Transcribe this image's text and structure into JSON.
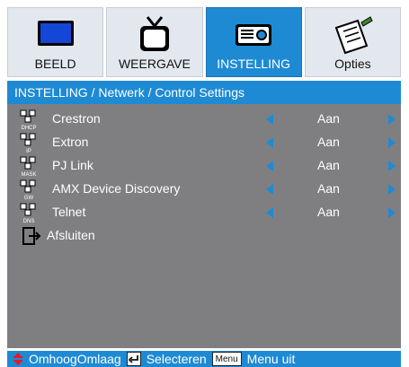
{
  "tabs": [
    {
      "label": "BEELD",
      "icon": "monitor-icon",
      "active": false
    },
    {
      "label": "WEERGAVE",
      "icon": "tv-icon",
      "active": false
    },
    {
      "label": "INSTELLING",
      "icon": "projector-icon",
      "active": true
    },
    {
      "label": "Opties",
      "icon": "notepad-icon",
      "active": false
    }
  ],
  "breadcrumb": "INSTELLING / Netwerk / Control Settings",
  "items": [
    {
      "label": "Crestron",
      "value": "Aan",
      "icon_text": "DHCP"
    },
    {
      "label": "Extron",
      "value": "Aan",
      "icon_text": "IP"
    },
    {
      "label": "PJ Link",
      "value": "Aan",
      "icon_text": "MASK"
    },
    {
      "label": "AMX Device Discovery",
      "value": "Aan",
      "icon_text": "GW"
    },
    {
      "label": "Telnet",
      "value": "Aan",
      "icon_text": "DNS"
    }
  ],
  "exit": {
    "label": "Afsluiten",
    "icon": "exit-icon"
  },
  "footer": {
    "updown_label": "OmhoogOmlaag",
    "select_label": "Selecteren",
    "menu_key": "Menu",
    "menu_label": "Menu uit"
  },
  "colors": {
    "accent": "#1e8ad4",
    "panel": "#7f7f82",
    "tab_bg": "#e3e8ee"
  }
}
